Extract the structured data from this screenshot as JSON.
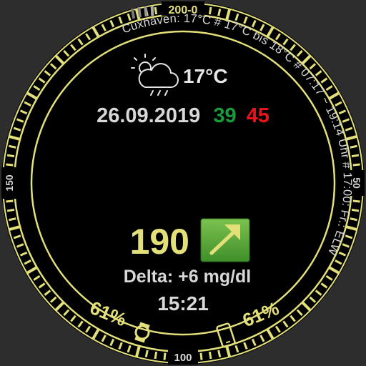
{
  "scale": {
    "top": "200-0",
    "left": "150",
    "right": "50",
    "bottom": "100"
  },
  "ring_text": "Cuxhaven: 17°C # 17°C bis 18°C # 07:17 ~ 19:14 Uhr # 17:00: Fr.: ELW",
  "weather": {
    "icon": "cloud-sun-rain-icon",
    "temperature": "17°C"
  },
  "date": "26.09.2019",
  "stat_green": "39",
  "stat_red": "45",
  "glucose": {
    "value": "190",
    "trend_icon": "arrow-up-right-icon",
    "delta": "Delta: +6 mg/dl",
    "time": "15:21"
  },
  "battery": {
    "watch": "61%",
    "watch_icon": "watch-icon",
    "phone": "61%",
    "phone_icon": "phone-icon"
  },
  "colors": {
    "accent": "#e3e07a",
    "green": "#1a9b3b",
    "red": "#e8141b",
    "trend_bg": "#5aa83a",
    "text": "#d8d8d8"
  }
}
